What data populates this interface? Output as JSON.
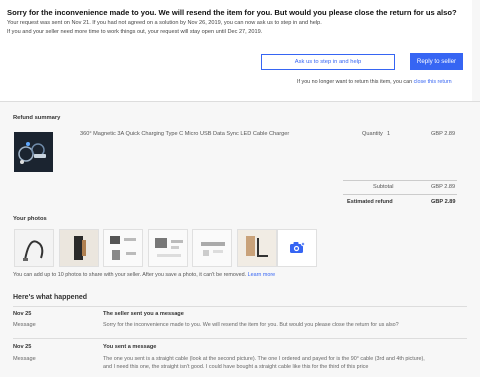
{
  "banner": {
    "heading": "Sorry for the inconvenience made to you. We will resend the item for you. But would you please close the return for us also?",
    "line1": "Your request was sent on Nov 21. If you had not agreed on a solution by Nov 26, 2019, you can now ask us to step in and help.",
    "line2": "If you and your seller need more time to work things out, your request will stay open until Dec 27, 2019.",
    "ask_button": "Ask us to step in and help",
    "reply_button": "Reply to seller",
    "close_prefix": "If you no longer want to return this item, you can",
    "close_link": "close this return"
  },
  "refund": {
    "title": "Refund summary",
    "item_title": "360° Magnetic 3A Quick Charging Type C Micro USB Data Sync LED Cable Charger",
    "quantity_label": "Quantity",
    "quantity": "1",
    "item_price": "GBP 2.89",
    "subtotal_label": "Subtotal",
    "subtotal": "GBP 2.89",
    "estimated_label": "Estimated refund",
    "estimated": "GBP 2.89"
  },
  "photos": {
    "title": "Your photos",
    "note": "You can add up to 10 photos to share with your seller. After you save a photo, it can't be removed.",
    "learn_more": "Learn more",
    "add_icon": "camera-add-icon"
  },
  "history": {
    "title": "Here's what happened",
    "messages": [
      {
        "date": "Nov 25",
        "from": "The seller sent you a message",
        "label": "Message",
        "text": "Sorry for the inconvenience made to you. We will resend the item for you. But would you please close the return for us also?"
      },
      {
        "date": "Nov 25",
        "from": "You sent a message",
        "label": "Message",
        "text": "The one you sent is a straight cable (look at the second picture). The one I ordered and payed for is the 90° cable (3rd and 4th picture), and I need this one, the straight isn't good. I could have bought a straight cable like this for the third of this price"
      }
    ]
  },
  "colors": {
    "accent": "#3665f3",
    "background": "#f7f7f7"
  }
}
